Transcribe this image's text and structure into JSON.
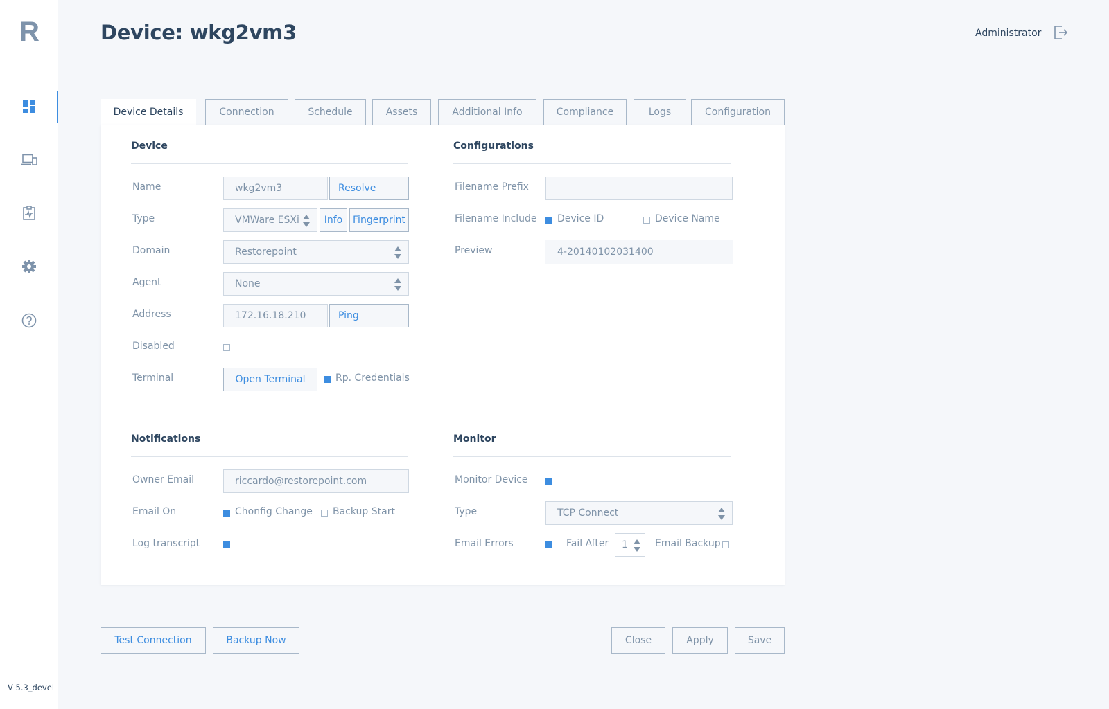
{
  "app": {
    "logo": "R",
    "version": "V 5.3_devel"
  },
  "sidebar": {
    "items": [
      {
        "icon": "dashboard-icon",
        "active": true
      },
      {
        "icon": "devices-icon",
        "active": false
      },
      {
        "icon": "reports-icon",
        "active": false
      },
      {
        "icon": "gear-icon",
        "active": false
      },
      {
        "icon": "help-icon",
        "active": false
      }
    ]
  },
  "header": {
    "title": "Device: wkg2vm3",
    "user": "Administrator",
    "logout_icon": "logout-icon"
  },
  "tabs": [
    {
      "label": "Device Details",
      "active": true
    },
    {
      "label": "Connection"
    },
    {
      "label": "Schedule"
    },
    {
      "label": "Assets"
    },
    {
      "label": "Additional Info"
    },
    {
      "label": "Compliance"
    },
    {
      "label": "Logs"
    },
    {
      "label": "Configuration"
    }
  ],
  "device": {
    "title": "Device",
    "name_label": "Name",
    "name_value": "wkg2vm3",
    "resolve_label": "Resolve",
    "type_label": "Type",
    "type_value": "VMWare ESXi",
    "info_label": "Info",
    "fingerprint_label": "Fingerprint",
    "domain_label": "Domain",
    "domain_value": "Restorepoint",
    "agent_label": "Agent",
    "agent_value": "None",
    "address_label": "Address",
    "address_value": "172.16.18.210",
    "ping_label": "Ping",
    "disabled_label": "Disabled",
    "disabled_checked": false,
    "terminal_label": "Terminal",
    "open_terminal_label": "Open Terminal",
    "rp_credentials_label": "Rp. Credentials",
    "rp_credentials_checked": true
  },
  "configurations": {
    "title": "Configurations",
    "prefix_label": "Filename Prefix",
    "prefix_value": "",
    "include_label": "Filename Include",
    "device_id_label": "Device ID",
    "device_id_checked": true,
    "device_name_label": "Device Name",
    "device_name_checked": false,
    "preview_label": "Preview",
    "preview_value": "4-20140102031400"
  },
  "notifications": {
    "title": "Notifications",
    "owner_email_label": "Owner Email",
    "owner_email_value": "riccardo@restorepoint.com",
    "email_on_label": "Email On",
    "config_change_label": "Chonfig Change",
    "config_change_checked": true,
    "backup_start_label": "Backup Start",
    "backup_start_checked": false,
    "log_transcript_label": "Log transcript",
    "log_transcript_checked": true
  },
  "monitor": {
    "title": "Monitor",
    "monitor_device_label": "Monitor Device",
    "monitor_device_checked": true,
    "type_label": "Type",
    "type_value": "TCP Connect",
    "email_errors_label": "Email Errors",
    "email_errors_checked": true,
    "fail_after_label": "Fail After",
    "fail_after_value": "1",
    "email_backup_label": "Email Backup",
    "email_backup_checked": false
  },
  "actions": {
    "test_connection": "Test Connection",
    "backup_now": "Backup Now",
    "close": "Close",
    "apply": "Apply",
    "save": "Save"
  },
  "colors": {
    "accent": "#3d8de0",
    "text": "#2e4660",
    "muted": "#7f93a8",
    "border": "#a8b8c9",
    "background": "#f5f7fa"
  }
}
